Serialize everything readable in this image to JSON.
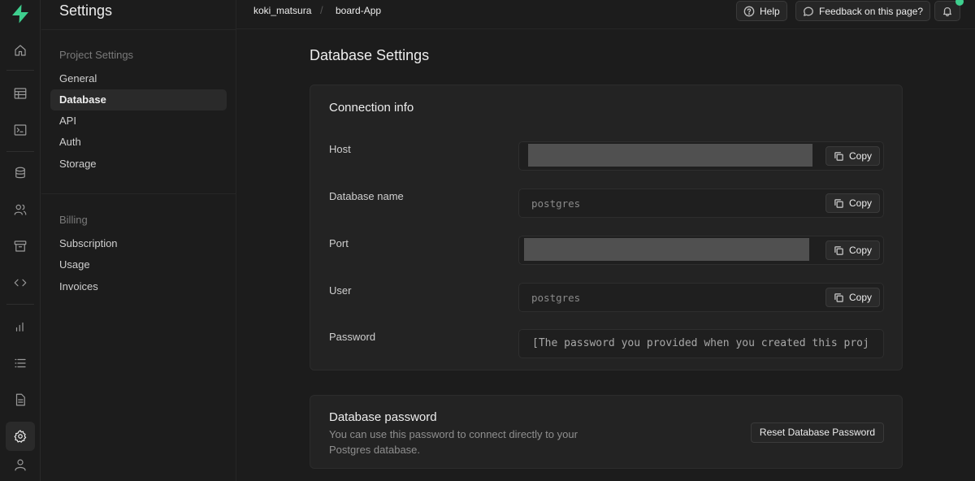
{
  "app": {
    "logo_icon": "supabase-bolt-icon",
    "accent": "#3ecf8e"
  },
  "rail": {
    "items": [
      {
        "name": "home-icon"
      },
      {
        "name": "table-editor-icon"
      },
      {
        "name": "sql-editor-icon"
      },
      {
        "name": "database-icon"
      },
      {
        "name": "users-icon"
      },
      {
        "name": "storage-icon"
      },
      {
        "name": "api-code-icon"
      },
      {
        "name": "reports-icon"
      },
      {
        "name": "logs-icon"
      },
      {
        "name": "docs-icon"
      },
      {
        "name": "settings-icon",
        "active": true
      },
      {
        "name": "account-icon"
      }
    ]
  },
  "sidenav": {
    "title": "Settings",
    "groups": [
      {
        "label": "Project Settings",
        "items": [
          {
            "label": "General"
          },
          {
            "label": "Database",
            "active": true
          },
          {
            "label": "API"
          },
          {
            "label": "Auth"
          },
          {
            "label": "Storage"
          }
        ]
      },
      {
        "label": "Billing",
        "items": [
          {
            "label": "Subscription"
          },
          {
            "label": "Usage"
          },
          {
            "label": "Invoices"
          }
        ]
      }
    ]
  },
  "topbar": {
    "breadcrumb": [
      "koki_matsura",
      "board-App"
    ],
    "separator": "/",
    "help_label": "Help",
    "feedback_label": "Feedback on this page?"
  },
  "main": {
    "title": "Database Settings",
    "connection": {
      "title": "Connection info",
      "copy_label": "Copy",
      "fields": [
        {
          "label": "Host",
          "value": "",
          "redacted": true
        },
        {
          "label": "Database name",
          "value": "postgres"
        },
        {
          "label": "Port",
          "value": "",
          "redacted": true
        },
        {
          "label": "User",
          "value": "postgres"
        },
        {
          "label": "Password",
          "value": "[The password you provided when you created this proj"
        }
      ]
    },
    "db_password": {
      "title": "Database password",
      "description": "You can use this password to connect directly to your Postgres database.",
      "reset_label": "Reset Database Password"
    }
  }
}
